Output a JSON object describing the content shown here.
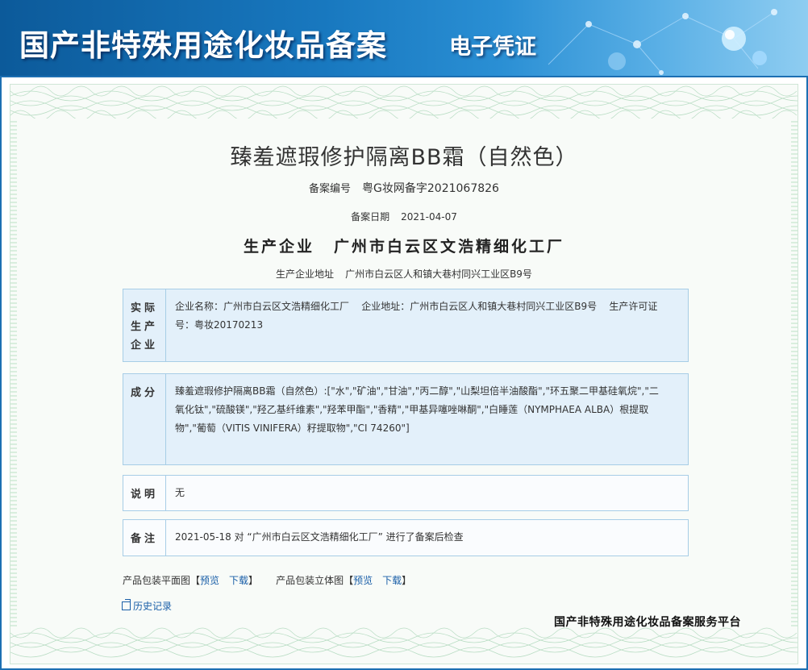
{
  "banner": {
    "title": "国产非特殊用途化妆品备案",
    "subtitle": "电子凭证"
  },
  "product": {
    "name": "臻羞遮瑕修护隔离BB霜（自然色）"
  },
  "record": {
    "number_label": "备案编号",
    "number_value": "粤G妆网备字2021067826",
    "date_label": "备案日期",
    "date_value": "2021-04-07"
  },
  "manufacturer": {
    "label": "生产企业",
    "name": "广州市白云区文浩精细化工厂",
    "address_label": "生产企业地址",
    "address_value": "广州市白云区人和镇大巷村同兴工业区B9号"
  },
  "actual_producer": {
    "label_lines": [
      "实际",
      "生产",
      "企业"
    ],
    "line1": "企业名称：广州市白云区文浩精细化工厂    企业地址：广州市白云区人和镇大巷村同兴工业区B9号    生产许可证",
    "line2": "号：粤妆20170213"
  },
  "ingredients": {
    "label": "成分",
    "lines": [
      "臻羞遮瑕修护隔离BB霜（自然色）:[\"水\",\"矿油\",\"甘油\",\"丙二醇\",\"山梨坦倍半油酸酯\",\"环五聚二甲基硅氧烷\",\"二",
      "氧化钛\",\"硫酸镁\",\"羟乙基纤维素\",\"羟苯甲酯\",\"香精\",\"甲基异噻唑啉酮\",\"白睡莲（NYMPHAEA ALBA）根提取",
      "物\",\"葡萄（VITIS VINIFERA）籽提取物\",\"CI 74260\"]"
    ]
  },
  "description": {
    "label": "说明",
    "value": "无"
  },
  "remarks": {
    "label": "备注",
    "value": "2021-05-18 对 “广州市白云区文浩精细化工厂” 进行了备案后检查"
  },
  "packaging": {
    "flat_label": "产品包装平面图【",
    "stereo_label": "产品包装立体图【",
    "close_bracket": "】",
    "preview": "预览",
    "download": "下载"
  },
  "history": {
    "label": "历史记录"
  },
  "platform": {
    "name": "国产非特殊用途化妆品备案服务平台"
  }
}
